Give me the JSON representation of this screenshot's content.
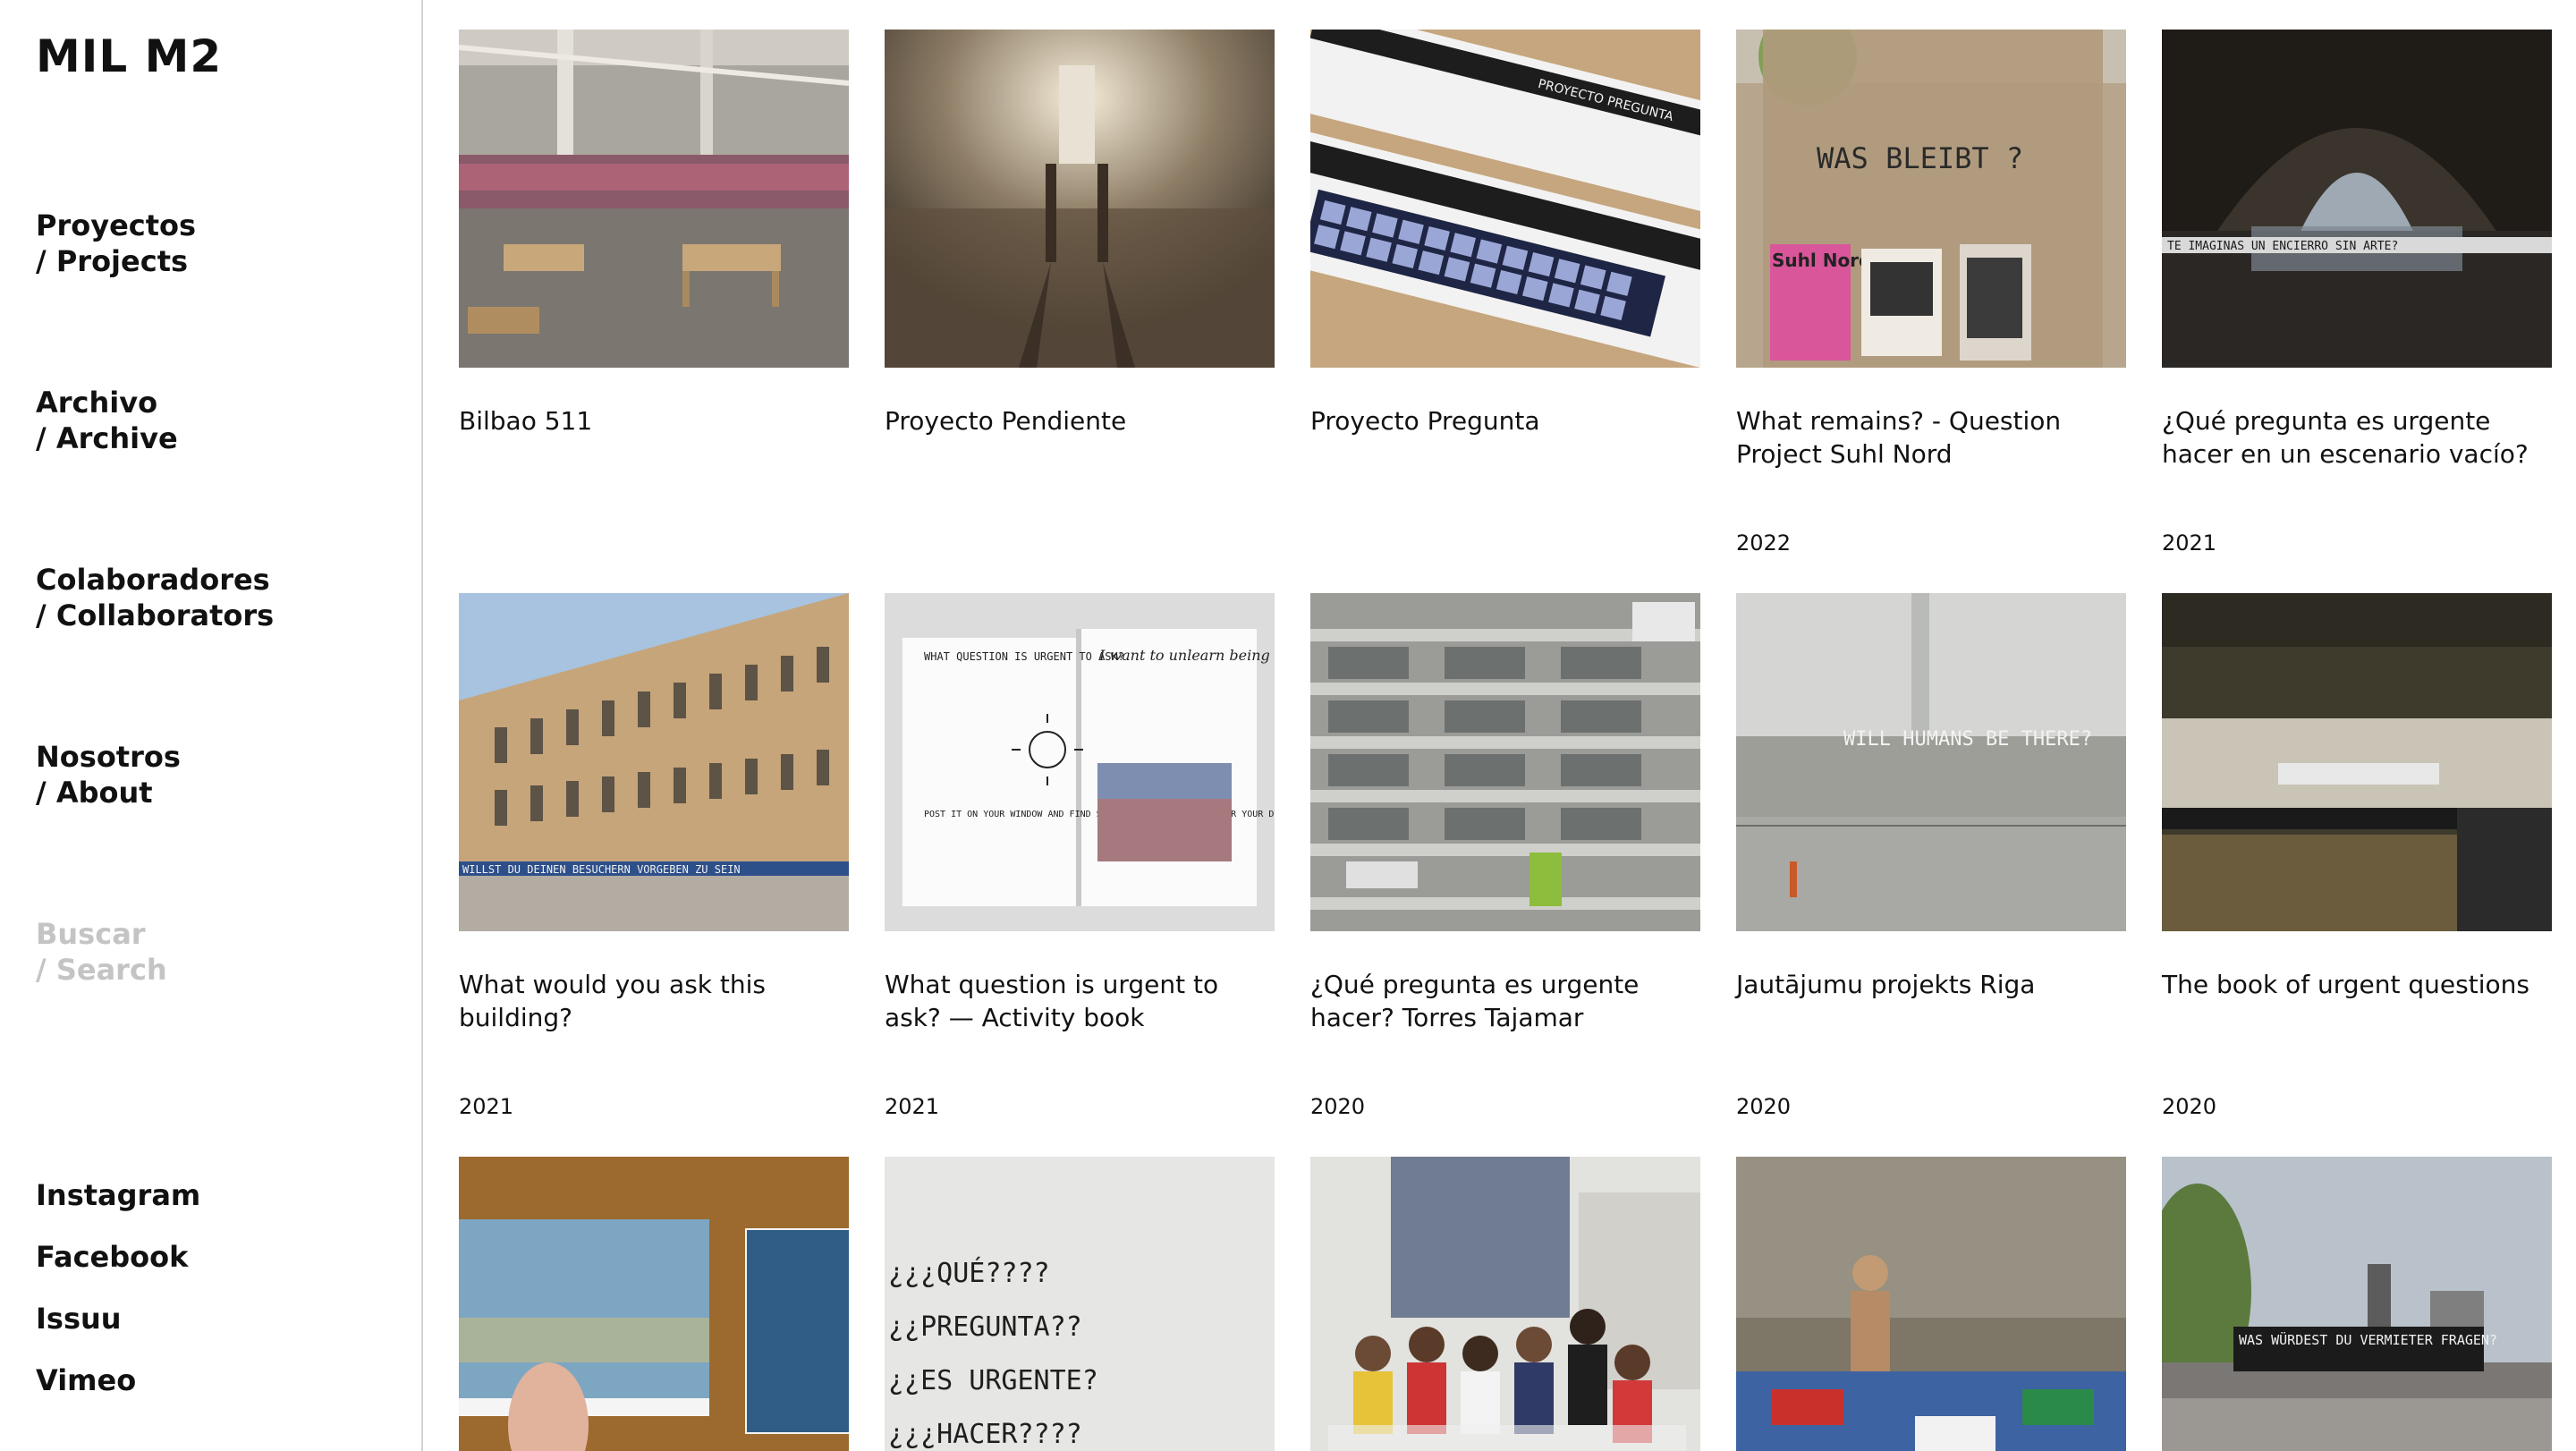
{
  "site": {
    "logo": "MIL M2"
  },
  "nav": {
    "projects": {
      "line1": "Proyectos",
      "line2": "/ Projects"
    },
    "archive": {
      "line1": "Archivo",
      "line2": "/ Archive"
    },
    "collaborators": {
      "line1": "Colaboradores",
      "line2": "/ Collaborators"
    },
    "about": {
      "line1": "Nosotros",
      "line2": "/ About"
    },
    "search": {
      "line1": "Buscar",
      "line2": "/ Search"
    }
  },
  "social": [
    "Instagram",
    "Facebook",
    "Issuu",
    "Vimeo"
  ],
  "projects": [
    {
      "title": "Bilbao 511",
      "year": ""
    },
    {
      "title": "Proyecto Pendiente",
      "year": ""
    },
    {
      "title": "Proyecto Pregunta",
      "year": ""
    },
    {
      "title": "What remains? - Question Project Suhl Nord",
      "year": "2022"
    },
    {
      "title": "¿Qué pregunta es urgente hacer en un escenario vacío?",
      "year": "2021"
    },
    {
      "title": "What would you ask this building?",
      "year": "2021"
    },
    {
      "title": "What question is urgent to ask? — Activity book",
      "year": "2021"
    },
    {
      "title": "¿Qué pregunta es urgente hacer? Torres Tajamar",
      "year": "2020"
    },
    {
      "title": "Jautājumu projekts Riga",
      "year": "2020"
    },
    {
      "title": "The book of urgent questions",
      "year": "2020"
    },
    {
      "title": "",
      "year": ""
    },
    {
      "title": "",
      "year": ""
    },
    {
      "title": "",
      "year": ""
    },
    {
      "title": "",
      "year": ""
    },
    {
      "title": "",
      "year": ""
    }
  ],
  "image_text": {
    "was_bleibt": "WAS BLEIBT ?",
    "suhl_nord_fest": "Suhl Nord Fest",
    "te_imaginas": "TE IMAGINAS UN ENCIERRO SIN ARTE?",
    "willst_du": "WILLST DU DEINEN BESUCHERN VORGEBEN ZU SEIN",
    "book_left": "WHAT QUESTION IS URGENT TO ASK?",
    "book_left2": "POST IT ON YOUR WINDOW AND FIND SOME SECRET MESSAGES UNDER YOUR DOOR",
    "book_right": "I want to unlearn being in a competition against too many people",
    "will_humans": "WILL HUMANS BE THERE?",
    "que_pregunta_tiles": [
      "¿¿¿QUÉ????",
      "¿¿PREGUNTA??",
      "¿¿ES URGENTE?",
      "¿¿¿HACER????"
    ],
    "was_wurdest": "WAS WÜRDEST DU VERMIETER FRAGEN?",
    "proyecto_pregunta": "PROYECTO PREGUNTA"
  }
}
